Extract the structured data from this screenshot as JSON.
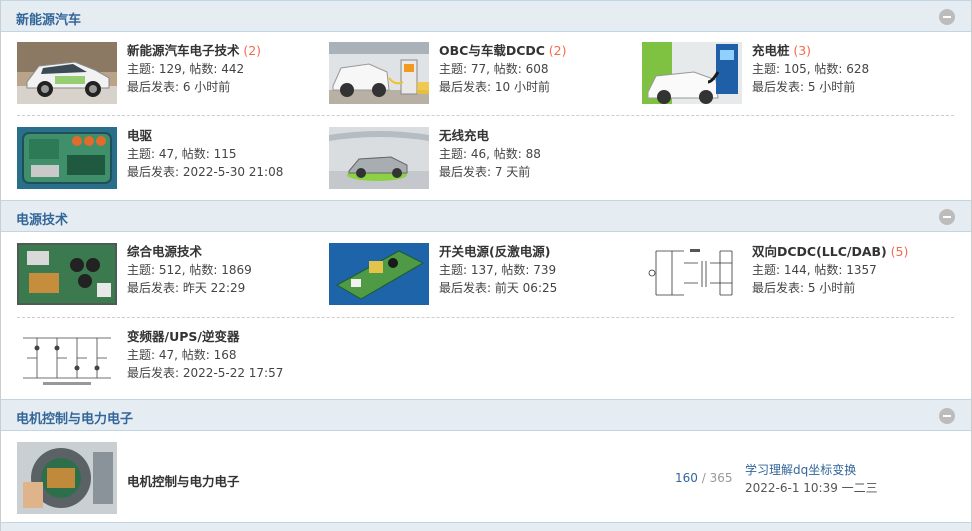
{
  "categories": [
    {
      "title": "新能源汽车",
      "forums": [
        {
          "name": "新能源汽车电子技术",
          "new": "(2)",
          "topics": "主题: 129, 帖数: 442",
          "last": "最后发表: 6 小时前"
        },
        {
          "name": "OBC与车载DCDC",
          "new": "(2)",
          "topics": "主题: 77, 帖数: 608",
          "last": "最后发表: 10 小时前"
        },
        {
          "name": "充电桩",
          "new": "(3)",
          "topics": "主题: 105, 帖数: 628",
          "last": "最后发表: 5 小时前"
        },
        {
          "name": "电驱",
          "new": "",
          "topics": "主题: 47, 帖数: 115",
          "last": "最后发表: 2022-5-30 21:08"
        },
        {
          "name": "无线充电",
          "new": "",
          "topics": "主题: 46, 帖数: 88",
          "last": "最后发表: 7 天前"
        }
      ]
    },
    {
      "title": "电源技术",
      "forums": [
        {
          "name": "综合电源技术",
          "new": "",
          "topics": "主题: 512, 帖数: 1869",
          "last": "最后发表: 昨天 22:29"
        },
        {
          "name": "开关电源(反激电源)",
          "new": "",
          "topics": "主题: 137, 帖数: 739",
          "last": "最后发表: 前天 06:25"
        },
        {
          "name": "双向DCDC(LLC/DAB)",
          "new": "(5)",
          "topics": "主题: 144, 帖数: 1357",
          "last": "最后发表: 5 小时前"
        },
        {
          "name": "变频器/UPS/逆变器",
          "new": "",
          "topics": "主题: 47, 帖数: 168",
          "last": "最后发表: 2022-5-22 17:57"
        }
      ]
    },
    {
      "title": "电机控制与电力电子",
      "forums": [
        {
          "name": "电机控制与电力电子",
          "threads": "160",
          "sep": "/",
          "posts": "365",
          "last_title": "学习理解dq坐标变换",
          "last_meta": "2022-6-1 10:39 一二三"
        }
      ]
    }
  ]
}
